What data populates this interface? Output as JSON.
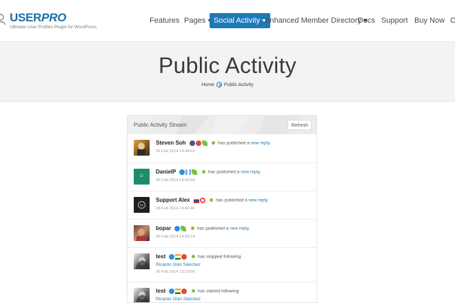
{
  "brand": {
    "name_bold": "USER",
    "name_italic": "PRO",
    "tagline": "Ultimate User Profiles Plugin for WordPress."
  },
  "nav": {
    "items": [
      {
        "label": "Features",
        "dropdown": false,
        "active": false
      },
      {
        "label": "Pages",
        "dropdown": true,
        "active": false
      },
      {
        "label": "Social Activity",
        "dropdown": true,
        "active": true
      },
      {
        "label": "Enhanced Member Directory",
        "dropdown": true,
        "active": false
      },
      {
        "label": "Docs",
        "dropdown": false,
        "active": false
      },
      {
        "label": "Support",
        "dropdown": false,
        "active": false
      },
      {
        "label": "Buy Now",
        "dropdown": false,
        "active": false
      },
      {
        "label": "C",
        "dropdown": false,
        "active": false
      }
    ]
  },
  "hero": {
    "title": "Public Activity",
    "breadcrumb": {
      "home": "Home",
      "current": "Public Activity"
    }
  },
  "stream": {
    "title": "Public Activity Stream",
    "refresh_label": "Refresh",
    "rows": [
      {
        "user": "Steven Soh",
        "action": "has published a",
        "link": "new reply.",
        "target": "",
        "time": "26 Feb 2014 14:44:01",
        "icons": [
          "facebook-icon",
          "google-plus-icon",
          "leaf-icon"
        ],
        "avatar": "photo"
      },
      {
        "user": "DanielP",
        "action": "has published a",
        "link": "new reply.",
        "target": "",
        "time": "26 Feb 2014 14:43:43",
        "icons": [
          "verified-icon",
          "flag-icon",
          "leaf-icon"
        ],
        "avatar": "letter",
        "avatar_letter": "D"
      },
      {
        "user": "Support Alex",
        "action": "has published a",
        "link": "new reply.",
        "target": "",
        "time": "26 Feb 2014 14:40:46",
        "icons": [
          "flag-icon",
          "lifebuoy-icon"
        ],
        "avatar": "wordpress"
      },
      {
        "user": "bopar",
        "action": "has published a",
        "link": "new reply.",
        "target": "",
        "time": "26 Feb 2014 14:29:19",
        "icons": [
          "verified-icon",
          "leaf-icon"
        ],
        "avatar": "photo"
      },
      {
        "user": "test",
        "action": "has stopped following",
        "link": "",
        "target": "Ricardo Olán Sánchez",
        "time": "26 Feb 2014 13:13:00",
        "icons": [
          "verified-icon",
          "flag-icon",
          "google-plus-icon"
        ],
        "avatar": "photo-bw"
      },
      {
        "user": "test",
        "action": "has started following",
        "link": "",
        "target": "Ricardo Olán Sánchez",
        "time": "",
        "icons": [
          "verified-icon",
          "flag-icon",
          "google-plus-icon"
        ],
        "avatar": "photo-bw"
      }
    ]
  },
  "colors": {
    "accent": "#1d7ab8",
    "online": "#7ac143",
    "avatar_green": "#1e8a6e",
    "avatar_dark": "#1f1f1f"
  }
}
